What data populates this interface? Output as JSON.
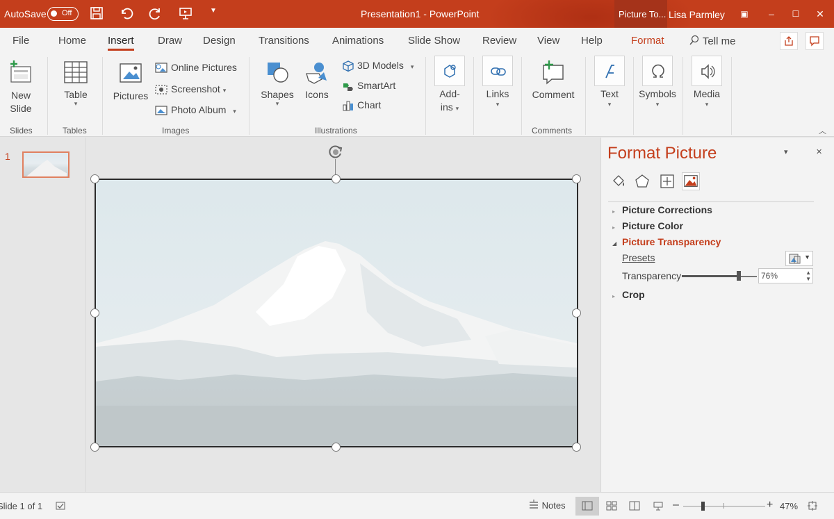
{
  "titlebar": {
    "autosave_label": "AutoSave",
    "autosave_state": "Off",
    "document_title": "Presentation1  -  PowerPoint",
    "contextual_tab": "Picture To...",
    "user": "Lisa Parmley",
    "accent": "#c43e1c"
  },
  "tabs": [
    {
      "label": "File"
    },
    {
      "label": "Home"
    },
    {
      "label": "Insert"
    },
    {
      "label": "Draw"
    },
    {
      "label": "Design"
    },
    {
      "label": "Transitions"
    },
    {
      "label": "Animations"
    },
    {
      "label": "Slide Show"
    },
    {
      "label": "Review"
    },
    {
      "label": "View"
    },
    {
      "label": "Help"
    },
    {
      "label": "Format"
    },
    {
      "label": "Tell me"
    }
  ],
  "ribbon": {
    "slides": {
      "new_slide_1": "New",
      "new_slide_2": "Slide",
      "group": "Slides"
    },
    "tables": {
      "table": "Table",
      "group": "Tables"
    },
    "images": {
      "pictures": "Pictures",
      "online_pictures": "Online Pictures",
      "screenshot": "Screenshot",
      "photo_album": "Photo Album",
      "group": "Images"
    },
    "illustrations": {
      "shapes": "Shapes",
      "icons": "Icons",
      "models": "3D Models",
      "smartart": "SmartArt",
      "chart": "Chart",
      "group": "Illustrations"
    },
    "addins": {
      "label_1": "Add-",
      "label_2": "ins"
    },
    "links": {
      "label": "Links"
    },
    "comments": {
      "comment": "Comment",
      "group": "Comments"
    },
    "text": {
      "label": "Text"
    },
    "symbols": {
      "label": "Symbols"
    },
    "media": {
      "label": "Media"
    }
  },
  "thumbnails": {
    "slide_number": "1"
  },
  "format_pane": {
    "title": "Format Picture",
    "sections": {
      "corrections": "Picture Corrections",
      "color": "Picture Color",
      "transparency": "Picture Transparency",
      "crop": "Crop"
    },
    "presets_label": "Presets",
    "transparency_label": "Transparency",
    "transparency_value": "76%",
    "transparency_fraction": 0.76
  },
  "statusbar": {
    "slide_info": "Slide 1 of 1",
    "notes": "Notes",
    "zoom": "47%",
    "zoom_fraction": 0.47
  }
}
